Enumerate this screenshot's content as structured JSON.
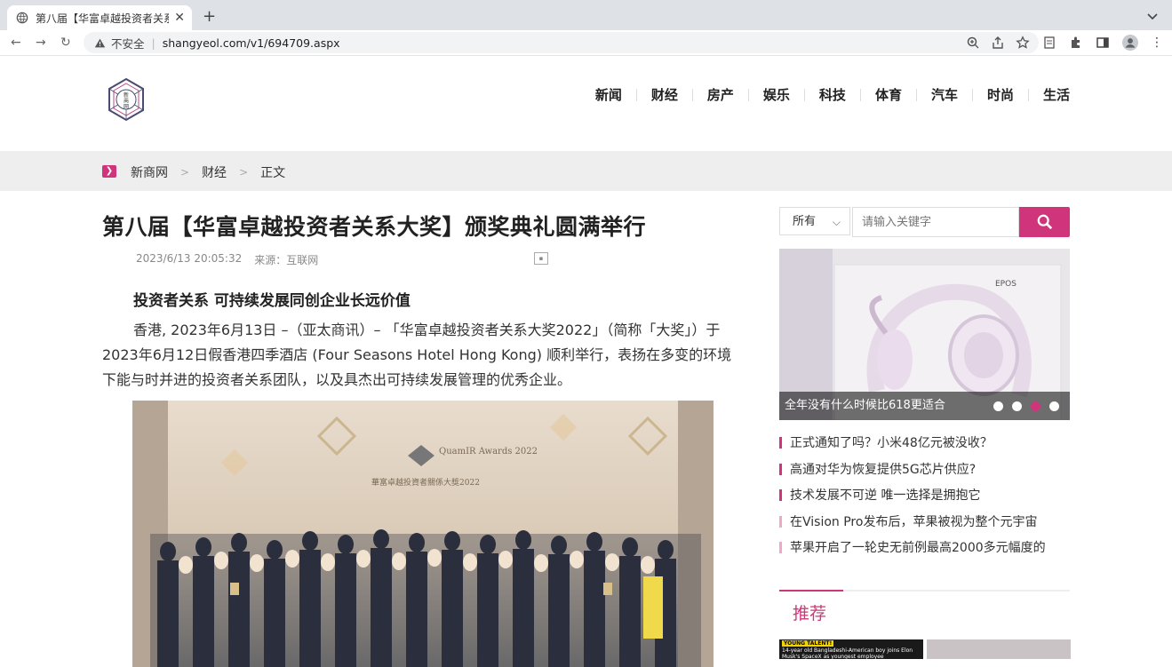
{
  "browser": {
    "tab_title": "第八届【华富卓越投资者关系大奖】",
    "insecure_label": "不安全",
    "url": "shangyeol.com/v1/694709.aspx"
  },
  "site": {
    "logo_text": "新商网",
    "nav": [
      "新闻",
      "财经",
      "房产",
      "娱乐",
      "科技",
      "体育",
      "汽车",
      "时尚",
      "生活"
    ]
  },
  "breadcrumb": {
    "items": [
      "新商网",
      "财经",
      "正文"
    ]
  },
  "article": {
    "title": "第八届【华富卓越投资者关系大奖】颁奖典礼圆满举行",
    "date": "2023/6/13 20:05:32",
    "source": "来源：互联网",
    "subtitle": "投资者关系 可持续发展同创企业长远价值",
    "paragraph": "香港, 2023年6月13日 –（亚太商讯）– 「华富卓越投资者关系大奖2022」（简称「大奖」）于2023年6月12日假香港四季酒店 (Four Seasons Hotel Hong Kong) 顺利举行，表扬在多变的环境下能与时并进的投资者关系团队，以及具杰出可持续发展管理的优秀企业。",
    "photo_backdrop_text": "QuamIR Awards 2022",
    "photo_backdrop_cn": "華富卓越投資者關係大獎2022"
  },
  "sidebar": {
    "search_scope": "所有",
    "search_placeholder": "请输入关键字",
    "banner_caption": "全年没有什么时候比618更适合",
    "banner_brand": "EPOS",
    "banner_dots": 4,
    "banner_active_dot": 3,
    "news": [
      "正式通知了吗？小米48亿元被没收？",
      "高通对华为恢复提供5G芯片供应?",
      "技术发展不可逆 唯一选择是拥抱它",
      "在Vision Pro发布后，苹果被视为整个元宇宙",
      "苹果开启了一轮史无前例最高2000多元幅度的"
    ],
    "recommend_title": "推荐",
    "thumb1_tag": "YOUNG TALENT!",
    "thumb1_text": "14-year old Bangladeshi-American boy joins Elon Musk's SpaceX as youngest employee"
  },
  "colors": {
    "accent": "#d0357b"
  }
}
